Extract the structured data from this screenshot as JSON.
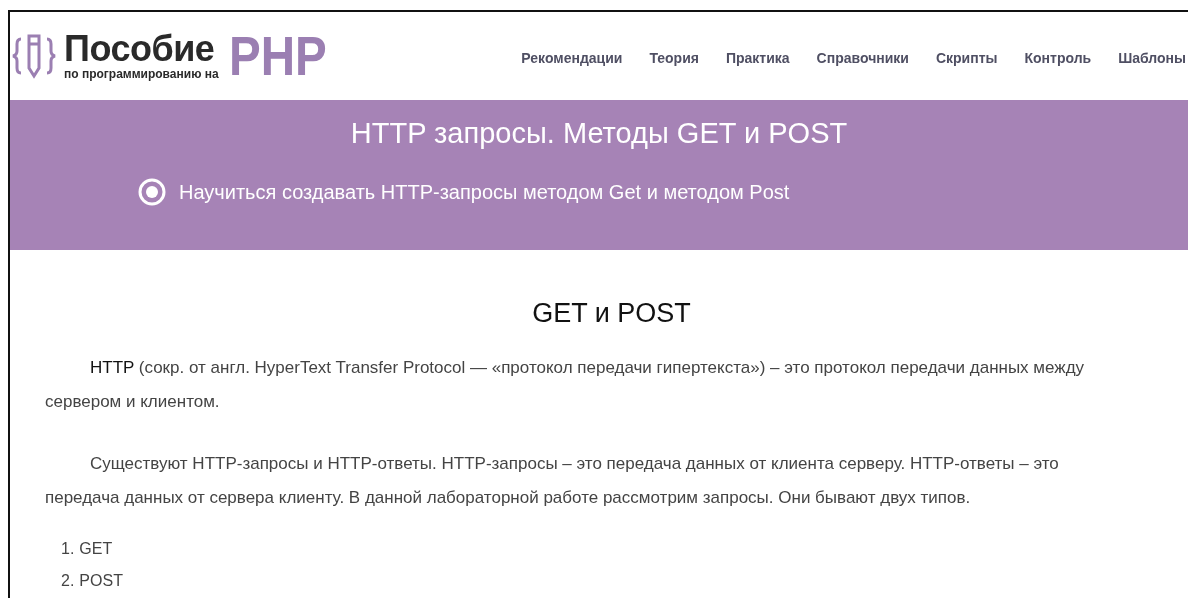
{
  "logo": {
    "title": "Пособие",
    "subtitle": "по программированию на",
    "accent": "PHP"
  },
  "nav": [
    "Рекомендации",
    "Теория",
    "Практика",
    "Справочники",
    "Скрипты",
    "Контроль",
    "Шаблоны"
  ],
  "hero": {
    "title": "HTTP запросы. Методы GET и POST",
    "goal": "Научиться создавать HTTP-запросы методом Get и методом Post"
  },
  "article": {
    "heading": "GET и POST",
    "paragraphs": [
      "**HTTP** (сокр. от англ. HyperText Transfer Protocol — «протокол передачи гипертекста») – это протокол передачи данных между сервером и клиентом.",
      "Существуют HTTP-запросы и HTTP-ответы. HTTP-запросы – это передача данных от клиента серверу. HTTP-ответы – это передача данных от сервера клиенту. В данной лабораторной работе рассмотрим запросы. Они бывают двух типов."
    ],
    "list": [
      {
        "number": "1.",
        "text": "GET"
      },
      {
        "number": "2.",
        "text": "POST"
      }
    ]
  }
}
